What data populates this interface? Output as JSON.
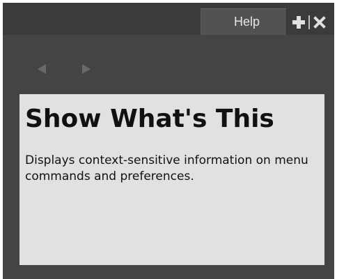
{
  "window": {
    "tab_label": "Help"
  },
  "toolbar": {
    "add_icon": "plus-icon",
    "close_icon": "close-icon"
  },
  "navigation": {
    "back_icon": "left-triangle-icon",
    "forward_icon": "right-triangle-icon"
  },
  "content": {
    "title": "Show What's This",
    "description": "Displays context-sensitive information on menu commands and preferences."
  },
  "colors": {
    "panel_background": "#444444",
    "tab_background": "#525252",
    "content_background": "#e1e1e1",
    "text": "#111111"
  }
}
